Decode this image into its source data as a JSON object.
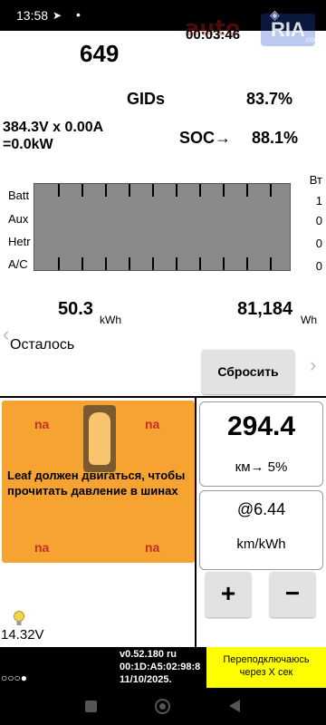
{
  "status_bar": {
    "time": "13:58",
    "telegram_icon": "telegram-icon",
    "dot_icon": "notification-dot-icon",
    "wifi_icon": "wifi-icon"
  },
  "watermark": {
    "auto": "auto",
    "ria": "RIA",
    "com": ".com"
  },
  "clock": "00:03:46",
  "battery": {
    "gids_count": "649",
    "gids_label": "GIDs",
    "gids_pct": "83.7%",
    "voltage_current": "384.3V x 0.00A",
    "power": "=0.0kW",
    "soc_label": "SOC→",
    "soc_value": "88.1%"
  },
  "power_rows": {
    "unit": "Вт",
    "labels": [
      "Batt",
      "Aux",
      "Hetr",
      "A/C"
    ],
    "values": [
      "1",
      "0",
      "0",
      "0"
    ]
  },
  "remaining": {
    "kwh_value": "50.3",
    "kwh_unit": "kWh",
    "wh_value": "81,184",
    "wh_unit": "Wh",
    "label": "Осталось",
    "reset_label": "Сбросить"
  },
  "tires": {
    "front_left": "na",
    "front_right": "na",
    "rear_left": "na",
    "rear_right": "na",
    "message": "Leaf должен двигаться, чтобы прочитать давление в шинах"
  },
  "range": {
    "value": "294.4",
    "label": "км→ 5%"
  },
  "efficiency": {
    "value": "@6.44",
    "unit": "km/kWh"
  },
  "buttons": {
    "plus": "+",
    "minus": "−"
  },
  "aux_battery": {
    "voltage": "14.32V",
    "icon": "lightbulb-icon"
  },
  "bottom": {
    "dots": "○○○●",
    "version": "v0.52.180 ru",
    "mac": "00:1D:A5:02:98:8",
    "date": "11/10/2025.",
    "reconnect_line1": "Переподключаюсь",
    "reconnect_line2": "через X сек"
  },
  "nav": {
    "left_arrow": "‹",
    "right_arrow": "›"
  }
}
